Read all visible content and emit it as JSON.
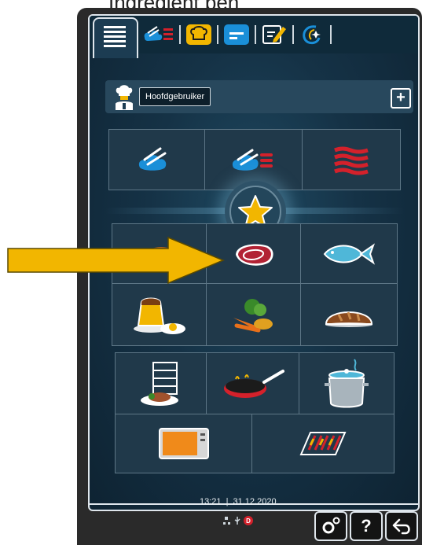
{
  "header": {
    "clipped_text": "Ingredient pen"
  },
  "tabs": [
    {
      "name": "list-tab",
      "icon": "list-icon",
      "active": true
    },
    {
      "name": "combi-tab",
      "icon": "steam-heat-icon"
    },
    {
      "name": "chef-tab",
      "icon": "chef-hat-icon"
    },
    {
      "name": "program-tab",
      "icon": "program-icon"
    },
    {
      "name": "edit-tab",
      "icon": "edit-icon"
    },
    {
      "name": "plus-tab",
      "icon": "sparkle-icon"
    }
  ],
  "user": {
    "label": "Hoofdgebruiker",
    "add_label": "+"
  },
  "modes": {
    "top": [
      "steam-icon",
      "combi-icon",
      "heat-icon"
    ]
  },
  "favorites": {
    "icon": "star-icon"
  },
  "food": [
    "poultry-icon",
    "meat-icon",
    "fish-icon",
    "egg-dessert-icon",
    "vegetables-icon",
    "bread-icon"
  ],
  "cooking": [
    "finishing-icon",
    "pan-frying-icon",
    "pot-icon",
    "convenience-oven-icon",
    "grill-icon"
  ],
  "status": {
    "time": "13:21",
    "divider": "|",
    "date": "31.12.2020"
  },
  "buttons": {
    "help": "?"
  },
  "colors": {
    "accent": "#f2b600",
    "steam_blue": "#1a8fd8",
    "heat_red": "#d4212b",
    "background": "#153246"
  }
}
